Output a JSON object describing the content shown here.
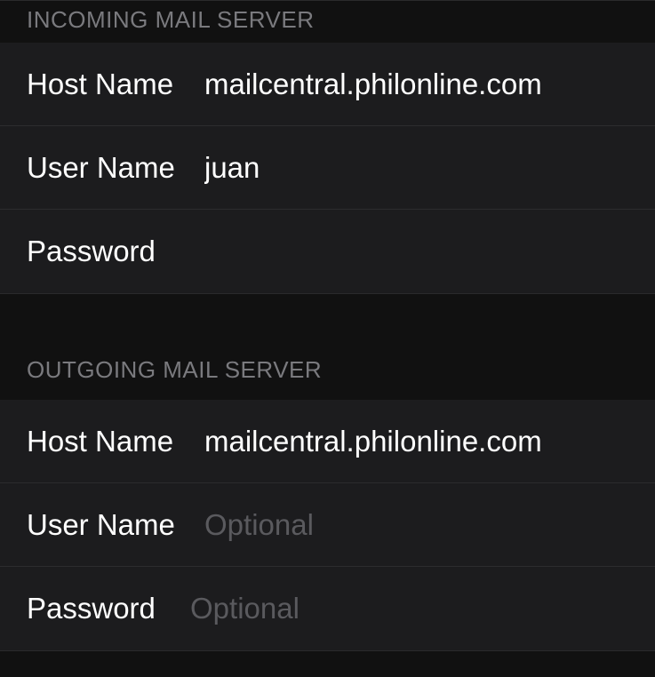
{
  "sections": {
    "incoming": {
      "header": "INCOMING MAIL SERVER",
      "hostname_label": "Host Name",
      "hostname_value": "mailcentral.philonline.com",
      "username_label": "User Name",
      "username_value": "juan",
      "password_label": "Password",
      "password_value": ""
    },
    "outgoing": {
      "header": "OUTGOING MAIL SERVER",
      "hostname_label": "Host Name",
      "hostname_value": "mailcentral.philonline.com",
      "username_label": "User Name",
      "username_value": "",
      "username_placeholder": "Optional",
      "password_label": "Password",
      "password_value": "",
      "password_placeholder": "Optional"
    }
  }
}
